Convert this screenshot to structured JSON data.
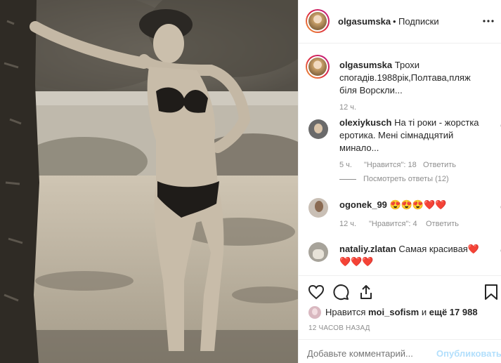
{
  "header": {
    "username": "olgasumska",
    "separator": "•",
    "follow_label": "Подписки",
    "more_icon": "ellipsis-icon"
  },
  "caption": {
    "username": "olgasumska",
    "text": "Трохи спогадів.1988рік,Полтава,пляж біля Ворскли...",
    "time": "12 ч."
  },
  "comments": [
    {
      "username": "olexiykusch",
      "text": "На ті роки - жорстка еротика. Мені сімнадцятий минало...",
      "time": "5 ч.",
      "likes": "\"Нравится\": 18",
      "reply": "Ответить",
      "view_replies": "Посмотреть ответы (12)"
    },
    {
      "username": "ogonek_99",
      "text": "😍😍😍❤️❤️",
      "time": "12 ч.",
      "likes": "\"Нравится\": 4",
      "reply": "Ответить"
    },
    {
      "username": "nataliy.zlatan",
      "text": "Самая красивая❤️",
      "text2": "❤️❤️❤️"
    }
  ],
  "actions": {
    "like_icon": "heart-icon",
    "comment_icon": "comment-icon",
    "share_icon": "share-icon",
    "save_icon": "bookmark-icon"
  },
  "likes": {
    "prefix": "Нравится",
    "user": "moi_sofism",
    "middle": "и",
    "count": "ещё 17 988"
  },
  "timestamp": "12 ЧАСОВ НАЗАД",
  "comment_box": {
    "placeholder": "Добавьте комментарий...",
    "publish_label": "Опубликовать"
  },
  "colors": {
    "link_disabled": "#b2dffc",
    "heart_red": "#ed4956",
    "text": "#262626",
    "muted": "#8e8e8e"
  }
}
